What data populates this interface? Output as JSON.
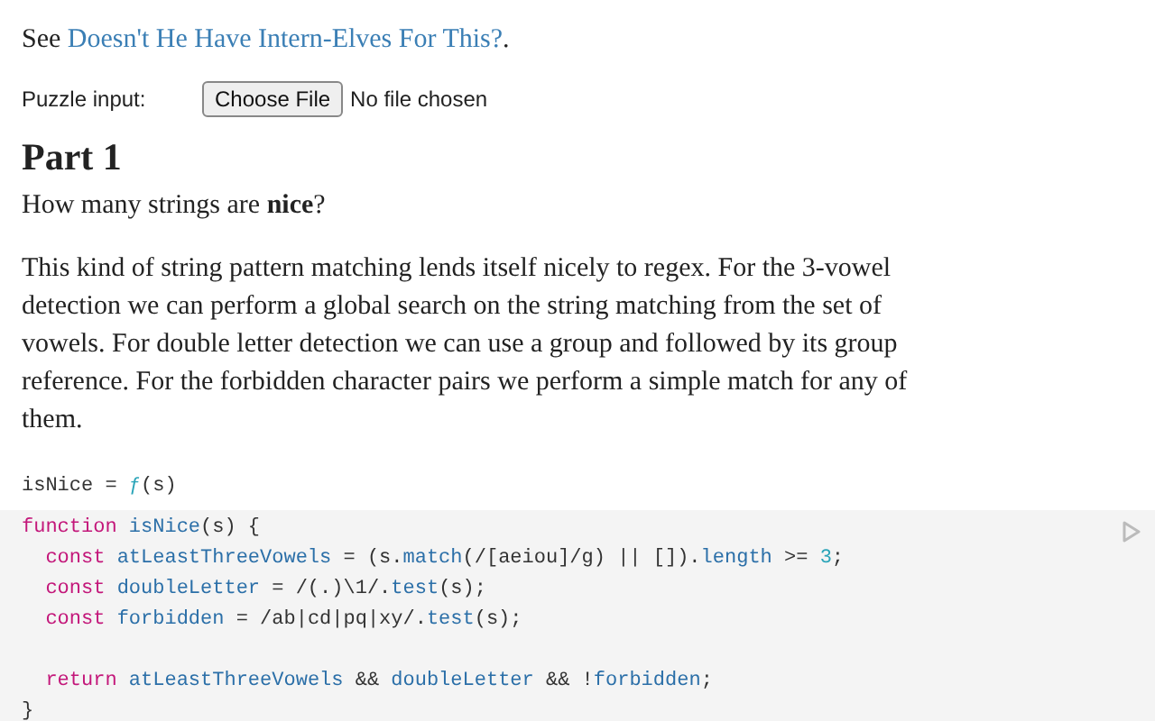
{
  "intro": {
    "prefix": "See ",
    "link": "Doesn't He Have Intern-Elves For This?",
    "suffix": "."
  },
  "input": {
    "label": "Puzzle input:",
    "button": "Choose File",
    "status": "No file chosen"
  },
  "heading": "Part 1",
  "question": "How many strings are **nice**?",
  "paragraph": "This kind of string pattern matching lends itself nicely to regex. For the 3-vowel detection we can perform a global search on the string matching from the set of vowels. For double letter detection we can use a group and followed by its group reference. For the forbidden character pairs we perform a simple match for any of them.",
  "cell_label": [
    {
      "text": "isNice = ",
      "kind": "plain"
    },
    {
      "text": "ƒ",
      "kind": "number"
    },
    {
      "text": "(s)",
      "kind": "plain"
    }
  ],
  "code": [
    {
      "kind": "code",
      "tokens": [
        {
          "text": "function ",
          "kind": "keyword"
        },
        {
          "text": "isNice",
          "kind": "name"
        },
        {
          "text": "(s) {",
          "kind": "plain"
        }
      ]
    },
    {
      "kind": "code",
      "tokens": [
        {
          "text": "  const ",
          "kind": "keyword"
        },
        {
          "text": "atLeastThreeVowels",
          "kind": "name"
        },
        {
          "text": " = (s.",
          "kind": "plain"
        },
        {
          "text": "match",
          "kind": "name"
        },
        {
          "text": "(/[aeiou]/g) || []).",
          "kind": "plain"
        },
        {
          "text": "length",
          "kind": "name"
        },
        {
          "text": " >= ",
          "kind": "plain"
        },
        {
          "text": "3",
          "kind": "number"
        },
        {
          "text": ";",
          "kind": "plain"
        }
      ]
    },
    {
      "kind": "code",
      "tokens": [
        {
          "text": "  const ",
          "kind": "keyword"
        },
        {
          "text": "doubleLetter",
          "kind": "name"
        },
        {
          "text": " = /(.)\\1/.",
          "kind": "plain"
        },
        {
          "text": "test",
          "kind": "name"
        },
        {
          "text": "(s);",
          "kind": "plain"
        }
      ]
    },
    {
      "kind": "code",
      "tokens": [
        {
          "text": "  const ",
          "kind": "keyword"
        },
        {
          "text": "forbidden",
          "kind": "name"
        },
        {
          "text": " = /ab|cd|pq|xy/.",
          "kind": "plain"
        },
        {
          "text": "test",
          "kind": "name"
        },
        {
          "text": "(s);",
          "kind": "plain"
        }
      ]
    },
    {
      "kind": "blank"
    },
    {
      "kind": "code",
      "tokens": [
        {
          "text": "  return ",
          "kind": "keyword"
        },
        {
          "text": "atLeastThreeVowels",
          "kind": "name"
        },
        {
          "text": " && ",
          "kind": "plain"
        },
        {
          "text": "doubleLetter",
          "kind": "name"
        },
        {
          "text": " && !",
          "kind": "plain"
        },
        {
          "text": "forbidden",
          "kind": "name"
        },
        {
          "text": ";",
          "kind": "plain"
        }
      ]
    },
    {
      "kind": "code",
      "tokens": [
        {
          "text": "}",
          "kind": "plain"
        }
      ]
    }
  ]
}
